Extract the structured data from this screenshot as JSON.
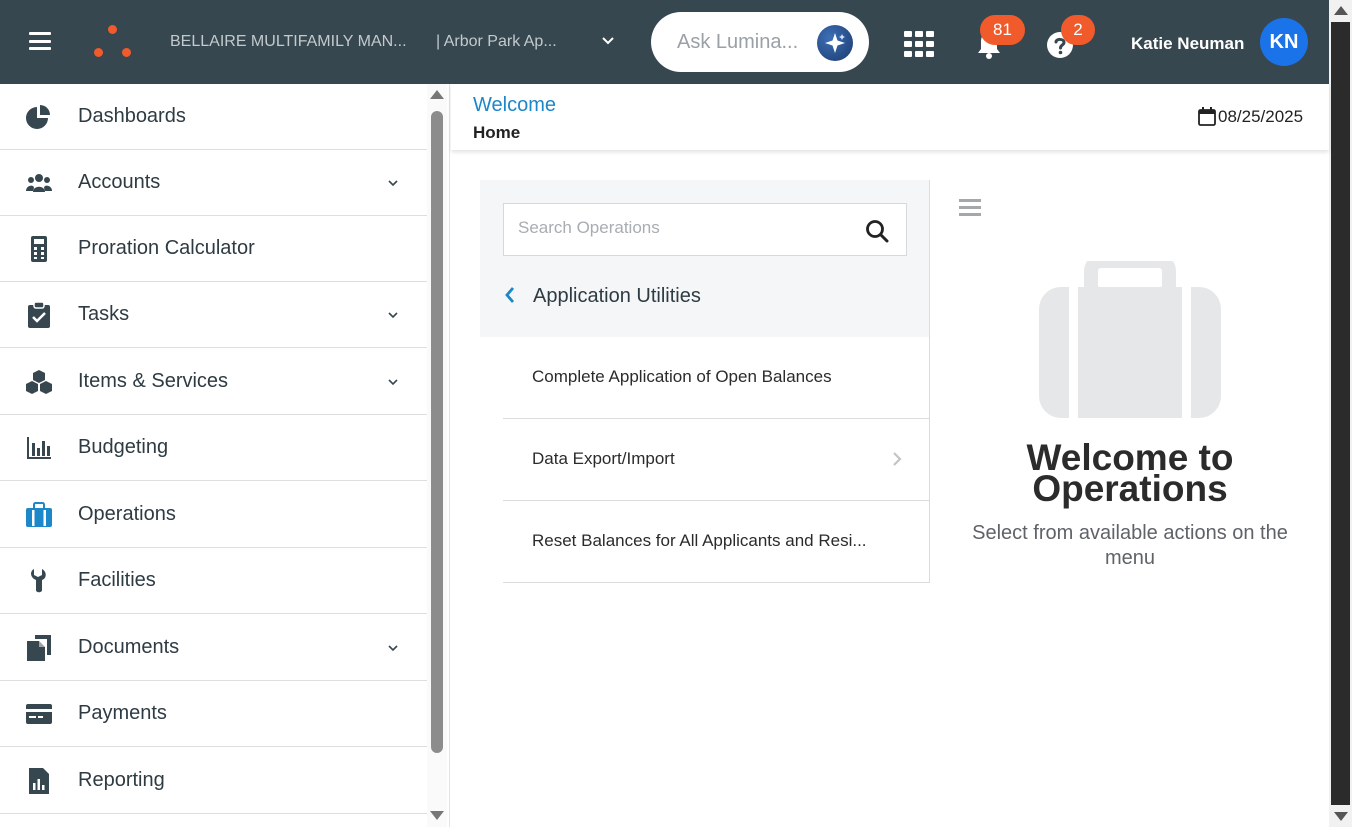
{
  "header": {
    "company": "BELLAIRE MULTIFAMILY MAN...",
    "property": "| Arbor Park Ap...",
    "ask_placeholder": "Ask Lumina...",
    "notifications_count": "81",
    "help_count": "2",
    "user_name": "Katie Neuman",
    "user_initials": "KN"
  },
  "sidebar": {
    "items": [
      {
        "label": "Dashboards",
        "icon": "pie-chart-icon"
      },
      {
        "label": "Accounts",
        "icon": "users-icon"
      },
      {
        "label": "Proration Calculator",
        "icon": "calculator-icon"
      },
      {
        "label": "Tasks",
        "icon": "clipboard-check-icon"
      },
      {
        "label": "Items & Services",
        "icon": "boxes-icon"
      },
      {
        "label": "Budgeting",
        "icon": "bar-chart-icon"
      },
      {
        "label": "Operations",
        "icon": "briefcase-icon"
      },
      {
        "label": "Facilities",
        "icon": "wrench-icon"
      },
      {
        "label": "Documents",
        "icon": "documents-icon"
      },
      {
        "label": "Payments",
        "icon": "credit-card-icon"
      },
      {
        "label": "Reporting",
        "icon": "report-icon"
      }
    ]
  },
  "content": {
    "breadcrumb_link": "Welcome",
    "breadcrumb_current": "Home",
    "date": "08/25/2025"
  },
  "operations": {
    "search_placeholder": "Search Operations",
    "section_title": "Application Utilities",
    "items": [
      {
        "label": "Complete Application of Open Balances"
      },
      {
        "label": "Data Export/Import"
      },
      {
        "label": "Reset Balances for All Applicants and Resi..."
      }
    ]
  },
  "welcome": {
    "title": "Welcome to Operations",
    "subtitle": "Select from available actions on the menu"
  },
  "colors": {
    "header_bg": "#37474f",
    "accent": "#1c87c9",
    "badge": "#f15a2b",
    "avatar": "#1a73e8"
  }
}
